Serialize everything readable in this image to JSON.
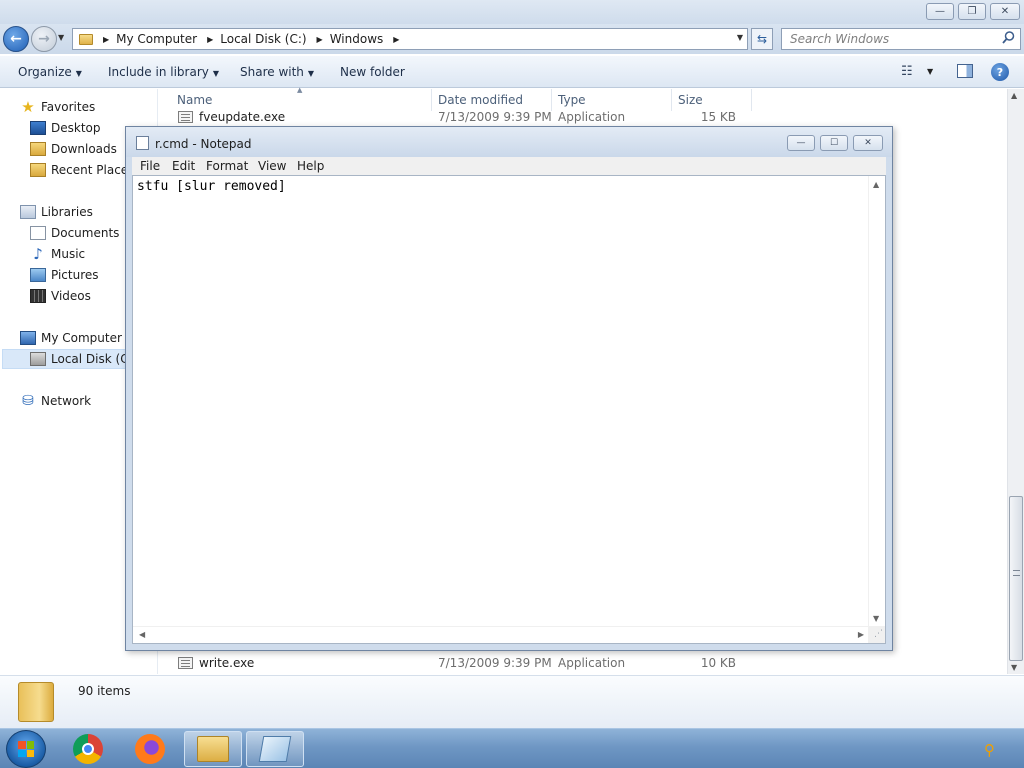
{
  "explorer": {
    "caption_buttons": {
      "minimize": "—",
      "restore": "❐",
      "close": "✕"
    },
    "nav": {
      "back": "←",
      "forward": "→",
      "recent_caret": "▼"
    },
    "address": {
      "crumbs": [
        "My Computer",
        "Local Disk (C:)",
        "Windows"
      ],
      "separator": "▶",
      "dropdown": "▼",
      "refresh": "⇆"
    },
    "search": {
      "placeholder": "Search Windows",
      "icon": "search-icon"
    },
    "command_bar": {
      "organize": "Organize",
      "include_in_library": "Include in library",
      "share_with": "Share with",
      "new_folder": "New folder",
      "caret": "▼",
      "views_icon": "☷",
      "help": "?"
    },
    "nav_pane": {
      "favorites": "Favorites",
      "desktop": "Desktop",
      "downloads": "Downloads",
      "recent_places": "Recent Places",
      "libraries": "Libraries",
      "documents": "Documents",
      "music": "Music",
      "pictures": "Pictures",
      "videos": "Videos",
      "my_computer": "My Computer",
      "local_disk": "Local Disk (C:)",
      "network": "Network"
    },
    "columns": {
      "name": "Name",
      "date_modified": "Date modified",
      "type": "Type",
      "size": "Size",
      "sort_indicator": "▲"
    },
    "files": [
      {
        "name": "fveupdate.exe",
        "date": "7/13/2009 9:39 PM",
        "type": "Application",
        "size": "15 KB"
      },
      {
        "name": "write.exe",
        "date": "7/13/2009 9:39 PM",
        "type": "Application",
        "size": "10 KB"
      }
    ],
    "scrollbar": {
      "up": "▲",
      "down": "▼"
    },
    "details": {
      "item_count": "90 items"
    }
  },
  "notepad": {
    "title": "r.cmd - Notepad",
    "caption_buttons": {
      "minimize": "—",
      "maximize": "☐",
      "close": "✕"
    },
    "menu": {
      "file": "File",
      "edit": "Edit",
      "format": "Format",
      "view": "View",
      "help": "Help"
    },
    "content": "stfu [slur removed]",
    "scroll": {
      "up": "▲",
      "down": "▼",
      "left": "◀",
      "right": "▶",
      "grip": "⋰"
    }
  },
  "taskbar": {
    "apps": [
      "chrome-icon",
      "firefox-icon",
      "explorer-icon",
      "notepad-icon"
    ],
    "tray_icon": "⚲",
    "windows_logo_colors": [
      "#f35325",
      "#81bc06",
      "#05a6f0",
      "#ffba08"
    ]
  }
}
